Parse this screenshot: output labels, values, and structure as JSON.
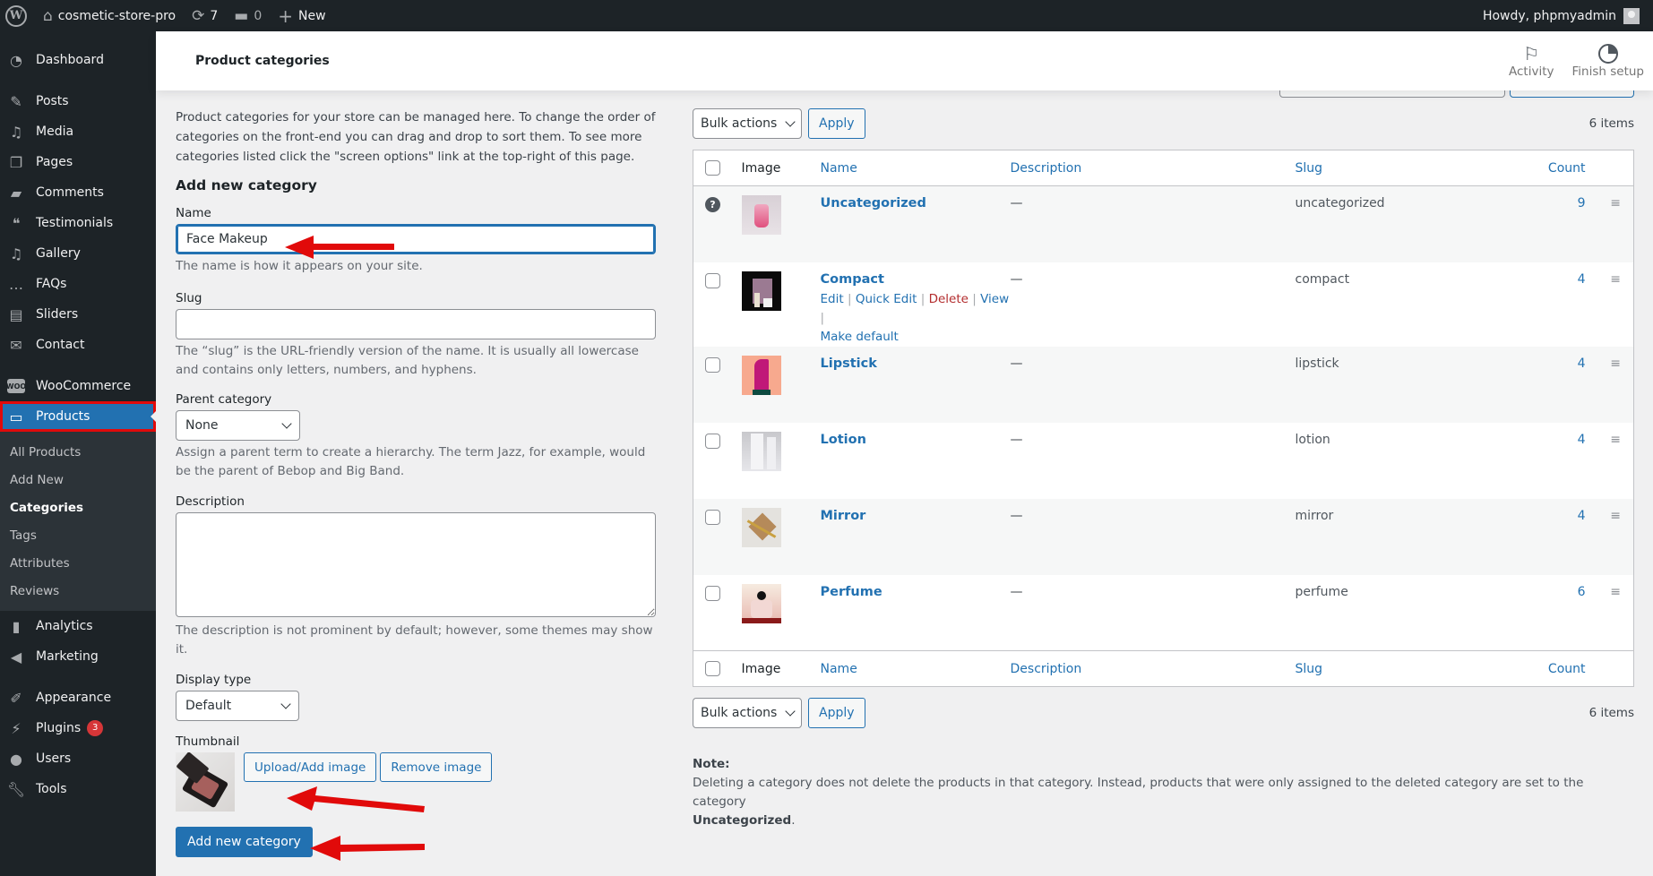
{
  "admin_bar": {
    "logo_icon": "wordpress-logo-icon",
    "site_name": "cosmetic-store-pro",
    "updates_count": "7",
    "comments_count": "0",
    "new_label": "New",
    "greeting": "Howdy, phpmyadmin"
  },
  "sidebar": {
    "items": [
      {
        "label": "Dashboard",
        "icon": "dashboard-icon"
      },
      {
        "label": "Posts",
        "icon": "pin-icon"
      },
      {
        "label": "Media",
        "icon": "media-icon"
      },
      {
        "label": "Pages",
        "icon": "pages-icon"
      },
      {
        "label": "Comments",
        "icon": "comment-icon"
      },
      {
        "label": "Testimonials",
        "icon": "testimonials-icon"
      },
      {
        "label": "Gallery",
        "icon": "gallery-icon"
      },
      {
        "label": "FAQs",
        "icon": "faq-icon"
      },
      {
        "label": "Sliders",
        "icon": "sliders-icon"
      },
      {
        "label": "Contact",
        "icon": "envelope-icon"
      },
      {
        "label": "WooCommerce",
        "icon": "woo-icon"
      },
      {
        "label": "Products",
        "icon": "archive-icon"
      },
      {
        "label": "Analytics",
        "icon": "bar-chart-icon"
      },
      {
        "label": "Marketing",
        "icon": "megaphone-icon"
      },
      {
        "label": "Appearance",
        "icon": "brush-icon"
      },
      {
        "label": "Plugins",
        "icon": "plug-icon",
        "badge": "3"
      },
      {
        "label": "Users",
        "icon": "user-icon"
      },
      {
        "label": "Tools",
        "icon": "wrench-icon"
      }
    ],
    "submenu": [
      "All Products",
      "Add New",
      "Categories",
      "Tags",
      "Attributes",
      "Reviews"
    ],
    "current_submenu": "Categories"
  },
  "header": {
    "title": "Product categories",
    "activity_label": "Activity",
    "finish_setup_label": "Finish setup"
  },
  "form": {
    "intro": "Product categories for your store can be managed here. To change the order of categories on the front-end you can drag and drop to sort them. To see more categories listed click the \"screen options\" link at the top-right of this page.",
    "heading": "Add new category",
    "name_label": "Name",
    "name_value": "Face Makeup",
    "name_help": "The name is how it appears on your site.",
    "slug_label": "Slug",
    "slug_value": "",
    "slug_help": "The “slug” is the URL-friendly version of the name. It is usually all lowercase and contains only letters, numbers, and hyphens.",
    "parent_label": "Parent category",
    "parent_value": "None",
    "parent_help": "Assign a parent term to create a hierarchy. The term Jazz, for example, would be the parent of Bebop and Big Band.",
    "description_label": "Description",
    "description_value": "",
    "description_help": "The description is not prominent by default; however, some themes may show it.",
    "display_type_label": "Display type",
    "display_type_value": "Default",
    "thumbnail_label": "Thumbnail",
    "upload_button": "Upload/Add image",
    "remove_button": "Remove image",
    "submit_button": "Add new category"
  },
  "table": {
    "bulk_actions": "Bulk actions",
    "apply": "Apply",
    "items_count": "6 items",
    "columns": {
      "image": "Image",
      "name": "Name",
      "description": "Description",
      "slug": "Slug",
      "count": "Count"
    },
    "rows": [
      {
        "name": "Uncategorized",
        "description": "—",
        "slug": "uncategorized",
        "count": "9",
        "default": true
      },
      {
        "name": "Compact",
        "description": "—",
        "slug": "compact",
        "count": "4",
        "hovered": true
      },
      {
        "name": "Lipstick",
        "description": "—",
        "slug": "lipstick",
        "count": "4"
      },
      {
        "name": "Lotion",
        "description": "—",
        "slug": "lotion",
        "count": "4"
      },
      {
        "name": "Mirror",
        "description": "—",
        "slug": "mirror",
        "count": "4"
      },
      {
        "name": "Perfume",
        "description": "—",
        "slug": "perfume",
        "count": "6"
      }
    ],
    "row_actions": {
      "edit": "Edit",
      "quick_edit": "Quick Edit",
      "delete": "Delete",
      "view": "View",
      "make_default": "Make default"
    }
  },
  "note": {
    "title": "Note:",
    "text": "Deleting a category does not delete the products in that category. Instead, products that were only assigned to the deleted category are set to the category",
    "default_category": "Uncategorized",
    "end": "."
  },
  "colors": {
    "accent": "#2271b1",
    "admin_bar": "#1d2327",
    "annotation": "#e10a0a",
    "delete": "#b32d2e"
  }
}
